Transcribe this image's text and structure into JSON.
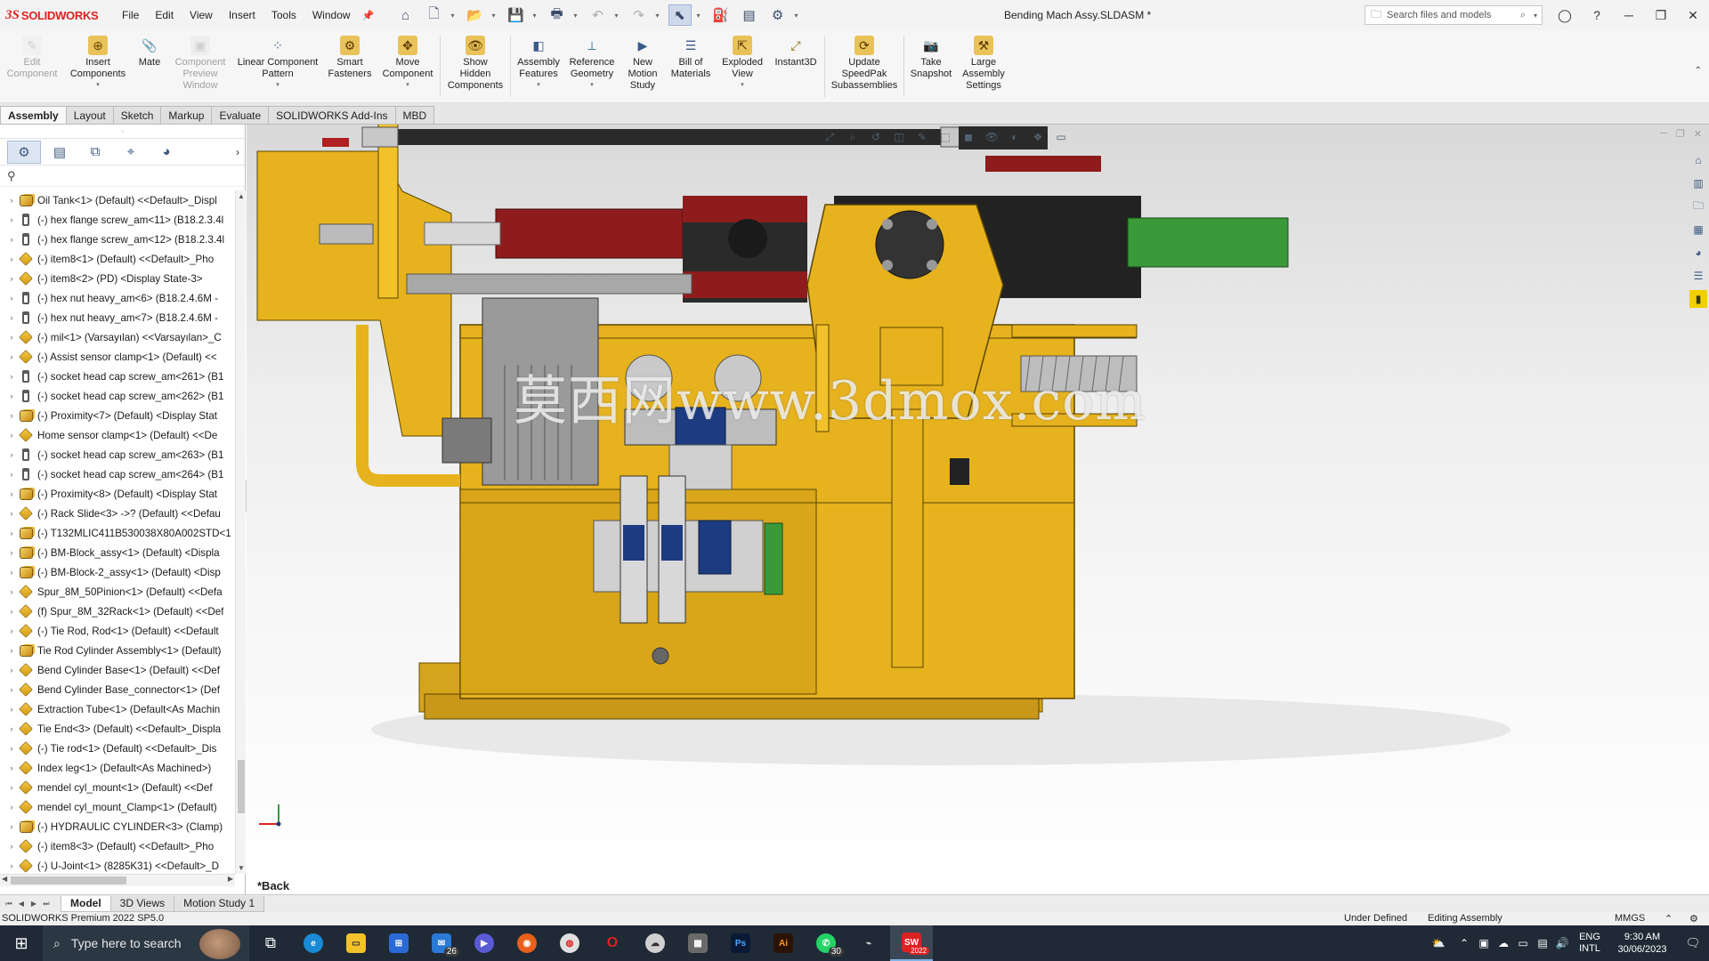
{
  "app": {
    "logo_ds": "3S",
    "logo_text": "SOLIDWORKS",
    "document_title": "Bending Mach Assy.SLDASM *",
    "menus": [
      "File",
      "Edit",
      "View",
      "Insert",
      "Tools",
      "Window"
    ],
    "search_placeholder": "Search files and models"
  },
  "command_manager": [
    {
      "label": "Edit\nComponent",
      "icon": "edit-component-icon",
      "enabled": false
    },
    {
      "label": "Insert\nComponents",
      "icon": "insert-components-icon",
      "enabled": true
    },
    {
      "label": "Mate",
      "icon": "mate-icon",
      "enabled": true
    },
    {
      "label": "Component\nPreview\nWindow",
      "icon": "component-preview-icon",
      "enabled": false
    },
    {
      "label": "Linear Component\nPattern",
      "icon": "linear-pattern-icon",
      "enabled": true
    },
    {
      "label": "Smart\nFasteners",
      "icon": "smart-fasteners-icon",
      "enabled": true
    },
    {
      "label": "Move\nComponent",
      "icon": "move-component-icon",
      "enabled": true
    },
    {
      "label": "Show\nHidden\nComponents",
      "icon": "show-hidden-icon",
      "enabled": true
    },
    {
      "label": "Assembly\nFeatures",
      "icon": "assembly-features-icon",
      "enabled": true
    },
    {
      "label": "Reference\nGeometry",
      "icon": "reference-geometry-icon",
      "enabled": true
    },
    {
      "label": "New\nMotion\nStudy",
      "icon": "motion-study-icon",
      "enabled": true
    },
    {
      "label": "Bill of\nMaterials",
      "icon": "bom-icon",
      "enabled": true
    },
    {
      "label": "Exploded\nView",
      "icon": "exploded-view-icon",
      "enabled": true
    },
    {
      "label": "Instant3D",
      "icon": "instant3d-icon",
      "enabled": true
    },
    {
      "label": "Update\nSpeedPak\nSubassemblies",
      "icon": "speedpak-icon",
      "enabled": true
    },
    {
      "label": "Take\nSnapshot",
      "icon": "snapshot-icon",
      "enabled": true
    },
    {
      "label": "Large\nAssembly\nSettings",
      "icon": "large-assembly-icon",
      "enabled": true
    }
  ],
  "tabs": [
    "Assembly",
    "Layout",
    "Sketch",
    "Markup",
    "Evaluate",
    "SOLIDWORKS Add-Ins",
    "MBD"
  ],
  "active_tab": "Assembly",
  "feature_tree": [
    {
      "text": "Oil Tank<1> (Default) <<Default>_Displ",
      "icon": "assembly"
    },
    {
      "text": "(-) hex flange screw_am<11> (B18.2.3.4l",
      "icon": "screw"
    },
    {
      "text": "(-) hex flange screw_am<12> (B18.2.3.4l",
      "icon": "screw"
    },
    {
      "text": "(-) item8<1> (Default) <<Default>_Pho",
      "icon": "part"
    },
    {
      "text": "(-) item8<2> (PD) <Display State-3>",
      "icon": "part"
    },
    {
      "text": "(-) hex nut heavy_am<6> (B18.2.4.6M -",
      "icon": "screw"
    },
    {
      "text": "(-) hex nut heavy_am<7> (B18.2.4.6M -",
      "icon": "screw"
    },
    {
      "text": "(-) mil<1> (Varsayılan) <<Varsayılan>_C",
      "icon": "part"
    },
    {
      "text": "(-) Assist sensor clamp<1> (Default) <<",
      "icon": "part"
    },
    {
      "text": "(-) socket head cap screw_am<261> (B1",
      "icon": "screw"
    },
    {
      "text": "(-) socket head cap screw_am<262> (B1",
      "icon": "screw"
    },
    {
      "text": "(-) Proximity<7> (Default) <Display Stat",
      "icon": "assembly"
    },
    {
      "text": "Home sensor clamp<1> (Default) <<De",
      "icon": "part"
    },
    {
      "text": "(-) socket head cap screw_am<263> (B1",
      "icon": "screw"
    },
    {
      "text": "(-) socket head cap screw_am<264> (B1",
      "icon": "screw"
    },
    {
      "text": "(-) Proximity<8> (Default) <Display Stat",
      "icon": "assembly"
    },
    {
      "text": "(-) Rack Slide<3> ->? (Default) <<Defau",
      "icon": "part"
    },
    {
      "text": "(-) T132MLIC411B530038X80A002STD<1",
      "icon": "assembly"
    },
    {
      "text": "(-) BM-Block_assy<1> (Default) <Displa",
      "icon": "assembly"
    },
    {
      "text": "(-) BM-Block-2_assy<1> (Default) <Disp",
      "icon": "assembly"
    },
    {
      "text": "Spur_8M_50Pinion<1> (Default) <<Defa",
      "icon": "part"
    },
    {
      "text": "(f) Spur_8M_32Rack<1> (Default) <<Def",
      "icon": "part"
    },
    {
      "text": "(-) Tie Rod, Rod<1> (Default) <<Default",
      "icon": "part"
    },
    {
      "text": "Tie Rod Cylinder Assembly<1> (Default)",
      "icon": "assembly"
    },
    {
      "text": "Bend Cylinder Base<1> (Default) <<Def",
      "icon": "part"
    },
    {
      "text": "Bend Cylinder Base_connector<1> (Def",
      "icon": "part"
    },
    {
      "text": "Extraction Tube<1> (Default<As Machin",
      "icon": "part"
    },
    {
      "text": "Tie End<3> (Default) <<Default>_Displa",
      "icon": "part"
    },
    {
      "text": "(-) Tie rod<1> (Default) <<Default>_Dis",
      "icon": "part"
    },
    {
      "text": "Index leg<1> (Default<As Machined>)",
      "icon": "part"
    },
    {
      "text": "mendel cyl_mount<1> (Default) <<Def",
      "icon": "part"
    },
    {
      "text": "mendel cyl_mount_Clamp<1> (Default)",
      "icon": "part"
    },
    {
      "text": "(-) HYDRAULIC CYLINDER<3> (Clamp)",
      "icon": "assembly"
    },
    {
      "text": "(-) item8<3> (Default) <<Default>_Pho",
      "icon": "part"
    },
    {
      "text": "(-) U-Joint<1> (8285K31) <<Default>_D",
      "icon": "part"
    }
  ],
  "viewport": {
    "view_label": "*Back",
    "watermark": "莫西网www.3dmox.com"
  },
  "bottom_tabs": [
    "Model",
    "3D Views",
    "Motion Study 1"
  ],
  "active_bottom_tab": "Model",
  "status": {
    "version": "SOLIDWORKS Premium 2022 SP5.0",
    "definition": "Under Defined",
    "mode": "Editing Assembly",
    "units": "MMGS"
  },
  "taskbar": {
    "search_placeholder": "Type here to search",
    "mail_badge": "26",
    "whatsapp_badge": "30",
    "sw_badge": "2022",
    "lang_line1": "ENG",
    "lang_line2": "INTL",
    "time": "9:30 AM",
    "date": "30/06/2023"
  },
  "colors": {
    "frame_yellow": "#e6b21e",
    "cylinder_red": "#8e1c1c",
    "valve_blue": "#1c3b80",
    "extension_green": "#3a9a3a",
    "solidworks_red": "#d22222"
  }
}
